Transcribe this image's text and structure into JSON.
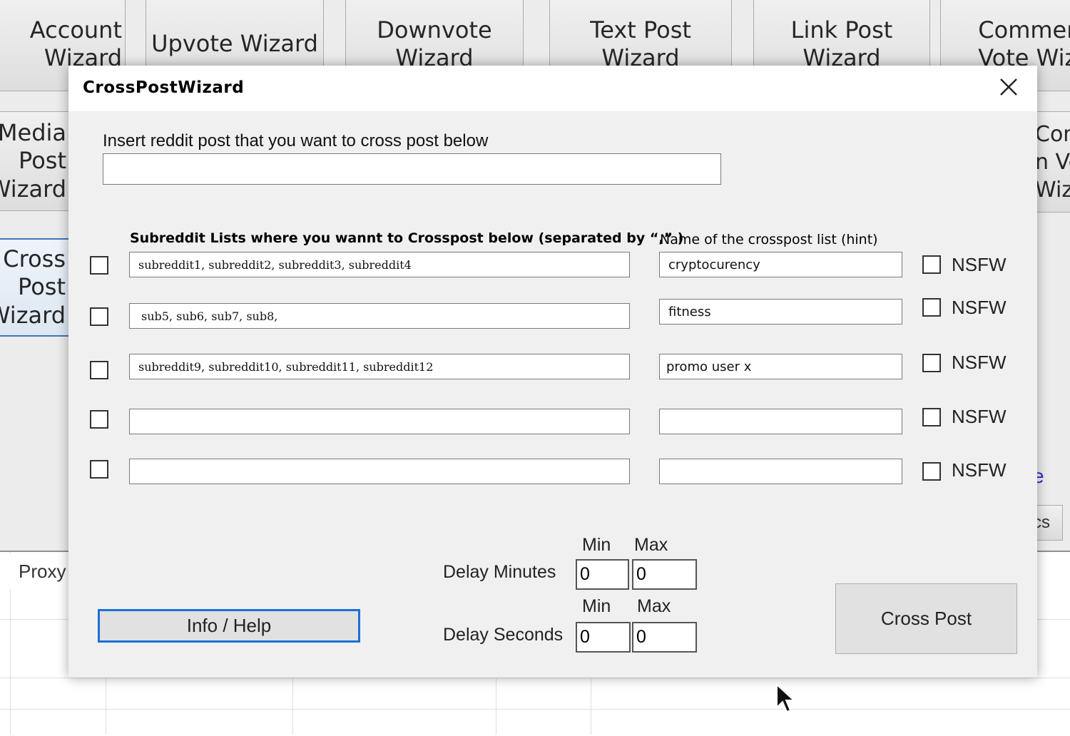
{
  "background": {
    "buttons": [
      {
        "label": "Account\nWizard"
      },
      {
        "label": "Upvote Wizard"
      },
      {
        "label": "Downvote\nWizard"
      },
      {
        "label": "Text Post\nWizard"
      },
      {
        "label": "Link Post\nWizard"
      },
      {
        "label": "Comments\nVote Wiz"
      },
      {
        "label": "Media Post\nWizard"
      },
      {
        "label": "Cross Post\nWizard"
      },
      {
        "label": "Comments\nn Vote\nWizard"
      }
    ],
    "proxy_label": "Proxy",
    "link_fragment": "e",
    "small_button_fragment": "cs"
  },
  "dialog": {
    "title": "CrossPostWizard",
    "post_label": "Insert reddit post that you want to cross post below",
    "post_value": "",
    "subreddit_header": "Subreddit Lists where you wannt to Crosspost below (separated by “,” )",
    "name_header": "Name of the crosspost list (hint)",
    "nsfw_label": "NSFW",
    "rows": [
      {
        "subreddits": "subreddit1, subreddit2, subreddit3, subreddit4",
        "name": "cryptocurency"
      },
      {
        "subreddits": "sub5, sub6, sub7, sub8,",
        "name": "fitness"
      },
      {
        "subreddits": "subreddit9, subreddit10, subreddit11, subreddit12",
        "name": "promo user x"
      },
      {
        "subreddits": "",
        "name": ""
      },
      {
        "subreddits": "",
        "name": ""
      }
    ],
    "min_label": "Min",
    "max_label": "Max",
    "delay_minutes_label": "Delay Minutes",
    "delay_seconds_label": "Delay Seconds",
    "delay_minutes_min": "0",
    "delay_minutes_max": "0",
    "delay_seconds_min": "0",
    "delay_seconds_max": "0",
    "info_button": "Info / Help",
    "cross_post_button": "Cross Post"
  },
  "colors": {
    "accent": "#1b6fd6",
    "dialog_bg": "#f0f0f0",
    "link": "#2a2ad8"
  }
}
